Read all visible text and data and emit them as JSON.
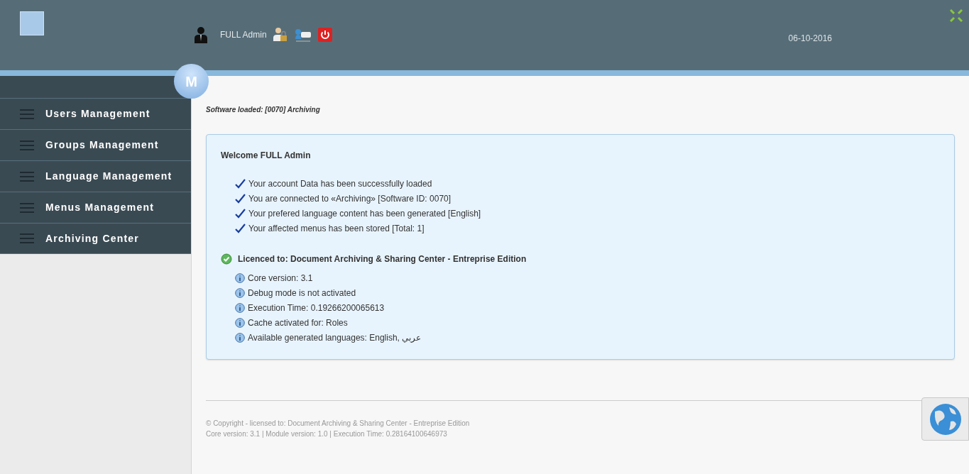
{
  "header": {
    "user_name": "FULL Admin",
    "date": "06-10-2016",
    "badge_letter": "M"
  },
  "sidebar": {
    "items": [
      {
        "label": "Users Management"
      },
      {
        "label": "Groups Management"
      },
      {
        "label": "Language Management"
      },
      {
        "label": "Menus Management"
      },
      {
        "label": "Archiving Center"
      }
    ]
  },
  "software_loaded": "Software loaded: [0070] Archiving",
  "welcome": {
    "title": "Welcome FULL Admin",
    "checks": [
      "Your account Data has been successfully loaded",
      "You are connected to «Archiving» [Software ID: 0070]",
      "Your prefered language content has been generated [English]",
      "Your affected menus has been stored [Total: 1]"
    ],
    "licence": "Licenced to: Document Archiving & Sharing Center - Entreprise Edition",
    "infos": [
      "Core version: 3.1",
      "Debug mode is not activated",
      "Execution Time: 0.19266200065613",
      "Cache activated for: Roles",
      "Available generated languages: English, عربي"
    ]
  },
  "footer": {
    "lines": [
      "© Copyright - licensed to: Document Archiving & Sharing Center - Entreprise Edition",
      "Core version: 3.1 | Module version: 1.0 | Execution Time: 0.28164100646973"
    ]
  }
}
